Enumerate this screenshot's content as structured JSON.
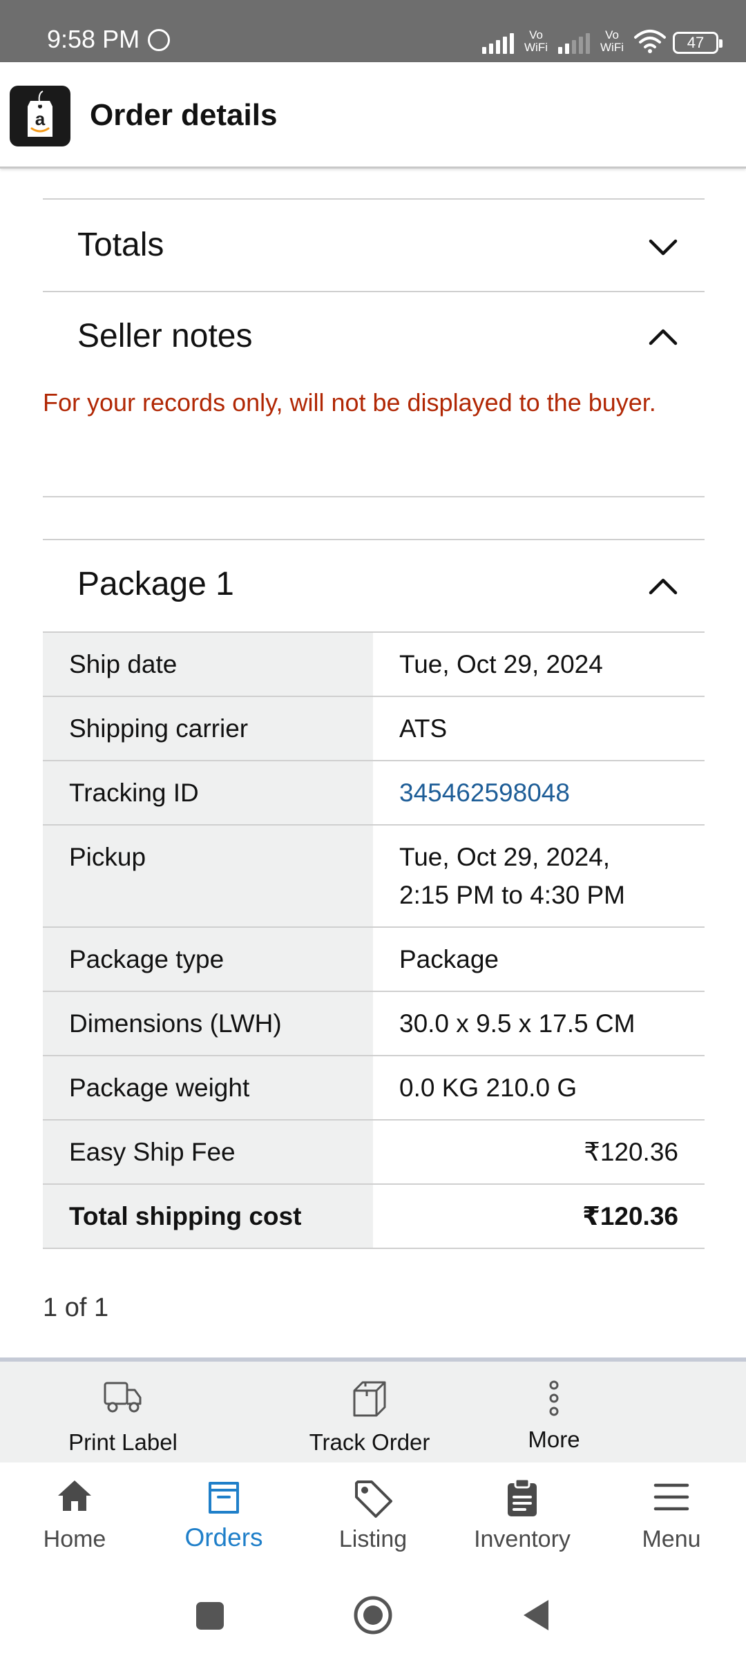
{
  "status_bar": {
    "time": "9:58 PM",
    "vowifi_1": "Vo WiFi",
    "vowifi_2": "Vo WiFi",
    "battery": "47"
  },
  "header": {
    "title": "Order details",
    "logo_letter": "a"
  },
  "sections": {
    "totals": "Totals",
    "seller_notes": "Seller notes",
    "seller_notes_text": "For your records only, will not be displayed to the buyer.",
    "package": "Package 1"
  },
  "package_rows": [
    {
      "label": "Ship date",
      "value": "Tue, Oct 29, 2024"
    },
    {
      "label": "Shipping carrier",
      "value": "ATS"
    },
    {
      "label": "Tracking ID",
      "value": "345462598048"
    },
    {
      "label": "Pickup",
      "value_line1": "Tue, Oct 29, 2024,",
      "value_line2": "2:15 PM to 4:30 PM"
    },
    {
      "label": "Package type",
      "value": "Package"
    },
    {
      "label": "Dimensions (LWH)",
      "value": "30.0 x 9.5 x 17.5 CM"
    },
    {
      "label": "Package weight",
      "value": "0.0 KG 210.0 G"
    },
    {
      "label": "Easy Ship Fee",
      "value": "₹120.36"
    },
    {
      "label": "Total shipping cost",
      "value": "₹120.36"
    }
  ],
  "pager": "1 of 1",
  "actions": {
    "print_label": "Print Label",
    "track_order": "Track Order",
    "more": "More"
  },
  "nav": {
    "home": "Home",
    "orders": "Orders",
    "listing": "Listing",
    "inventory": "Inventory",
    "menu": "Menu"
  },
  "colors": {
    "link": "#1d5d97",
    "note": "#b12704",
    "active_nav": "#1f7fc9"
  }
}
